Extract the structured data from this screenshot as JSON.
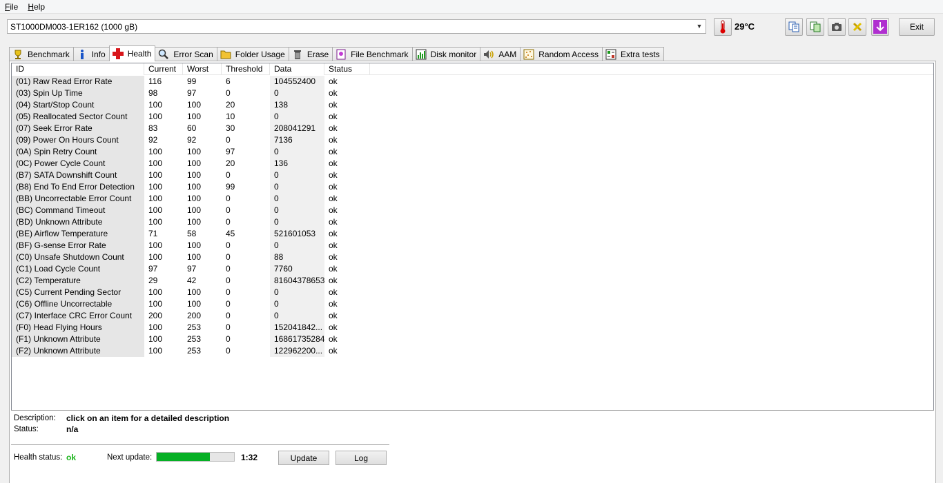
{
  "menu": {
    "file": "File",
    "file_accel": "F",
    "file_rest": "ile",
    "help_accel": "H",
    "help_rest": "elp"
  },
  "toolbar": {
    "drive": "ST1000DM003-1ER162 (1000 gB)",
    "temperature": "29°C",
    "exit_label": "Exit"
  },
  "tabs": [
    {
      "label": "Benchmark",
      "icon": "benchmark-icon"
    },
    {
      "label": "Info",
      "icon": "info-icon"
    },
    {
      "label": "Health",
      "icon": "health-cross-icon",
      "active": true
    },
    {
      "label": "Error Scan",
      "icon": "magnifier-icon"
    },
    {
      "label": "Folder Usage",
      "icon": "folder-icon"
    },
    {
      "label": "Erase",
      "icon": "trash-icon"
    },
    {
      "label": "File Benchmark",
      "icon": "file-benchmark-icon"
    },
    {
      "label": "Disk monitor",
      "icon": "disk-monitor-icon"
    },
    {
      "label": "AAM",
      "icon": "speaker-icon"
    },
    {
      "label": "Random Access",
      "icon": "random-access-icon"
    },
    {
      "label": "Extra tests",
      "icon": "extra-tests-icon"
    }
  ],
  "table": {
    "columns": [
      "ID",
      "Current",
      "Worst",
      "Threshold",
      "Data",
      "Status"
    ],
    "rows": [
      [
        "(01) Raw Read Error Rate",
        "116",
        "99",
        "6",
        "104552400",
        "ok"
      ],
      [
        "(03) Spin Up Time",
        "98",
        "97",
        "0",
        "0",
        "ok"
      ],
      [
        "(04) Start/Stop Count",
        "100",
        "100",
        "20",
        "138",
        "ok"
      ],
      [
        "(05) Reallocated Sector Count",
        "100",
        "100",
        "10",
        "0",
        "ok"
      ],
      [
        "(07) Seek Error Rate",
        "83",
        "60",
        "30",
        "208041291",
        "ok"
      ],
      [
        "(09) Power On Hours Count",
        "92",
        "92",
        "0",
        "7136",
        "ok"
      ],
      [
        "(0A) Spin Retry Count",
        "100",
        "100",
        "97",
        "0",
        "ok"
      ],
      [
        "(0C) Power Cycle Count",
        "100",
        "100",
        "20",
        "136",
        "ok"
      ],
      [
        "(B7) SATA Downshift Count",
        "100",
        "100",
        "0",
        "0",
        "ok"
      ],
      [
        "(B8) End To End Error Detection",
        "100",
        "100",
        "99",
        "0",
        "ok"
      ],
      [
        "(BB) Uncorrectable Error Count",
        "100",
        "100",
        "0",
        "0",
        "ok"
      ],
      [
        "(BC) Command Timeout",
        "100",
        "100",
        "0",
        "0",
        "ok"
      ],
      [
        "(BD) Unknown Attribute",
        "100",
        "100",
        "0",
        "0",
        "ok"
      ],
      [
        "(BE) Airflow Temperature",
        "71",
        "58",
        "45",
        "521601053",
        "ok"
      ],
      [
        "(BF) G-sense Error Rate",
        "100",
        "100",
        "0",
        "0",
        "ok"
      ],
      [
        "(C0) Unsafe Shutdown Count",
        "100",
        "100",
        "0",
        "88",
        "ok"
      ],
      [
        "(C1) Load Cycle Count",
        "97",
        "97",
        "0",
        "7760",
        "ok"
      ],
      [
        "(C2) Temperature",
        "29",
        "42",
        "0",
        "81604378653",
        "ok"
      ],
      [
        "(C5) Current Pending Sector",
        "100",
        "100",
        "0",
        "0",
        "ok"
      ],
      [
        "(C6) Offline Uncorrectable",
        "100",
        "100",
        "0",
        "0",
        "ok"
      ],
      [
        "(C7) Interface CRC Error Count",
        "200",
        "200",
        "0",
        "0",
        "ok"
      ],
      [
        "(F0) Head Flying Hours",
        "100",
        "253",
        "0",
        "152041842...",
        "ok"
      ],
      [
        "(F1) Unknown Attribute",
        "100",
        "253",
        "0",
        "16861735284",
        "ok"
      ],
      [
        "(F2) Unknown Attribute",
        "100",
        "253",
        "0",
        "122962200...",
        "ok"
      ]
    ]
  },
  "details": {
    "description_label": "Description:",
    "description_value": "click on an item for a detailed description",
    "status_label": "Status:",
    "status_value": "n/a"
  },
  "footer": {
    "health_label": "Health status:",
    "health_value": "ok",
    "next_update_label": "Next update:",
    "next_update_time": "1:32",
    "progress_fraction": 0.69,
    "update_label": "Update",
    "log_label": "Log"
  },
  "colors": {
    "ok_green": "#19b419",
    "progress_green": "#06b025"
  }
}
